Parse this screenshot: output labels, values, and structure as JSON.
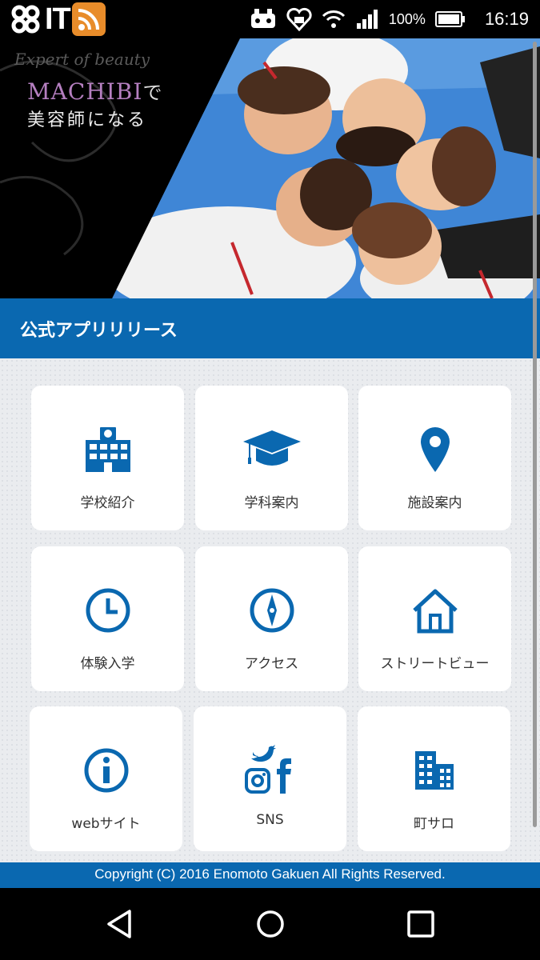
{
  "status_bar": {
    "app_logo_text": "IT",
    "battery_percent": "100%",
    "time": "16:19"
  },
  "hero": {
    "tagline": "Expert of beauty",
    "school_name": "MACHIBI",
    "school_suffix": "で",
    "catchphrase": "美容師になる"
  },
  "title_bar": {
    "title": "公式アプリリリース"
  },
  "menu": {
    "items": [
      {
        "label": "学校紹介",
        "icon": "school-building-icon"
      },
      {
        "label": "学科案内",
        "icon": "graduation-cap-icon"
      },
      {
        "label": "施設案内",
        "icon": "map-pin-icon"
      },
      {
        "label": "体験入学",
        "icon": "clock-icon"
      },
      {
        "label": "アクセス",
        "icon": "compass-icon"
      },
      {
        "label": "ストリートビュー",
        "icon": "home-icon"
      },
      {
        "label": "webサイト",
        "icon": "info-icon"
      },
      {
        "label": "SNS",
        "icon": "sns-icons"
      },
      {
        "label": "町サロ",
        "icon": "city-buildings-icon"
      }
    ]
  },
  "footer": {
    "copyright": "Copyright (C) 2016 Enomoto Gakuen All Rights Reserved."
  },
  "colors": {
    "accent_blue": "#0a68b0",
    "rss_orange": "#e88c2a"
  }
}
